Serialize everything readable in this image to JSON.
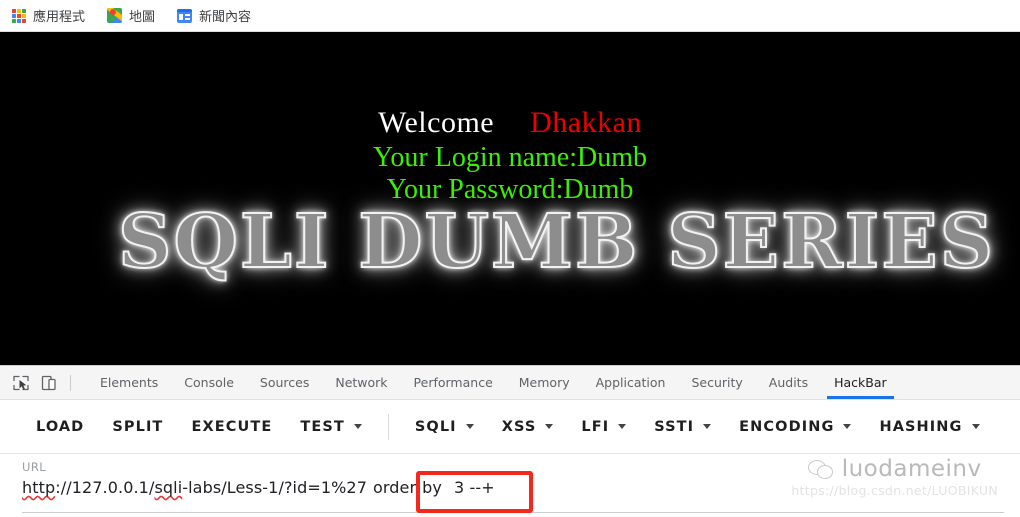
{
  "bookmarks": {
    "items": [
      {
        "label": "應用程式",
        "icon": "apps-grid-icon"
      },
      {
        "label": "地圖",
        "icon": "google-maps-icon"
      },
      {
        "label": "新聞內容",
        "icon": "google-news-icon"
      }
    ],
    "apps_icon_colors": [
      "#ea4335",
      "#fbbc05",
      "#34a853",
      "#4285f4",
      "#ea4335",
      "#fbbc05",
      "#34a853",
      "#4285f4",
      "#ea4335"
    ]
  },
  "page": {
    "welcome_word": "Welcome",
    "welcome_name": "Dhakkan",
    "login_line": "Your Login name:Dumb",
    "password_line": "Your Password:Dumb",
    "banner": "SQLI DUMB SERIES",
    "colors": {
      "background": "#000000",
      "welcome": "#ffffff",
      "name": "#ee0000",
      "credentials": "#3bf000"
    }
  },
  "devtools": {
    "tool_icons": [
      {
        "name": "inspect-element-icon"
      },
      {
        "name": "device-toolbar-icon"
      }
    ],
    "tabs": [
      {
        "label": "Elements",
        "active": false
      },
      {
        "label": "Console",
        "active": false
      },
      {
        "label": "Sources",
        "active": false
      },
      {
        "label": "Network",
        "active": false
      },
      {
        "label": "Performance",
        "active": false
      },
      {
        "label": "Memory",
        "active": false
      },
      {
        "label": "Application",
        "active": false
      },
      {
        "label": "Security",
        "active": false
      },
      {
        "label": "Audits",
        "active": false
      },
      {
        "label": "HackBar",
        "active": true
      }
    ],
    "active_tab": "HackBar",
    "active_tab_color": "#1a73e8"
  },
  "hackbar": {
    "buttons": [
      {
        "label": "LOAD",
        "caret": false
      },
      {
        "label": "SPLIT",
        "caret": false
      },
      {
        "label": "EXECUTE",
        "caret": false
      },
      {
        "label": "TEST",
        "caret": true
      },
      {
        "label": "SQLI",
        "caret": true
      },
      {
        "label": "XSS",
        "caret": true
      },
      {
        "label": "LFI",
        "caret": true
      },
      {
        "label": "SSTI",
        "caret": true
      },
      {
        "label": "ENCODING",
        "caret": true
      },
      {
        "label": "HASHING",
        "caret": true
      }
    ],
    "divider_after_index": 3,
    "url_label": "URL",
    "url_value": "http://127.0.0.1/sqli-labs/Less-1/?id=1%27 order by 3 --+",
    "url_parts": {
      "scheme": "http",
      "rest_before_labs": "://127.0.0.1/",
      "sqli_token": "sqli",
      "after_sqli": "-labs/Less-1/?id=1%27",
      "order": "order",
      "by": "by",
      "highlighted": "3 --+"
    },
    "highlight_color": "#f4291d"
  },
  "watermark": {
    "name": "luodameinv",
    "url": "https://blog.csdn.net/LUOBIKUN",
    "icon": "wechat-icon"
  }
}
